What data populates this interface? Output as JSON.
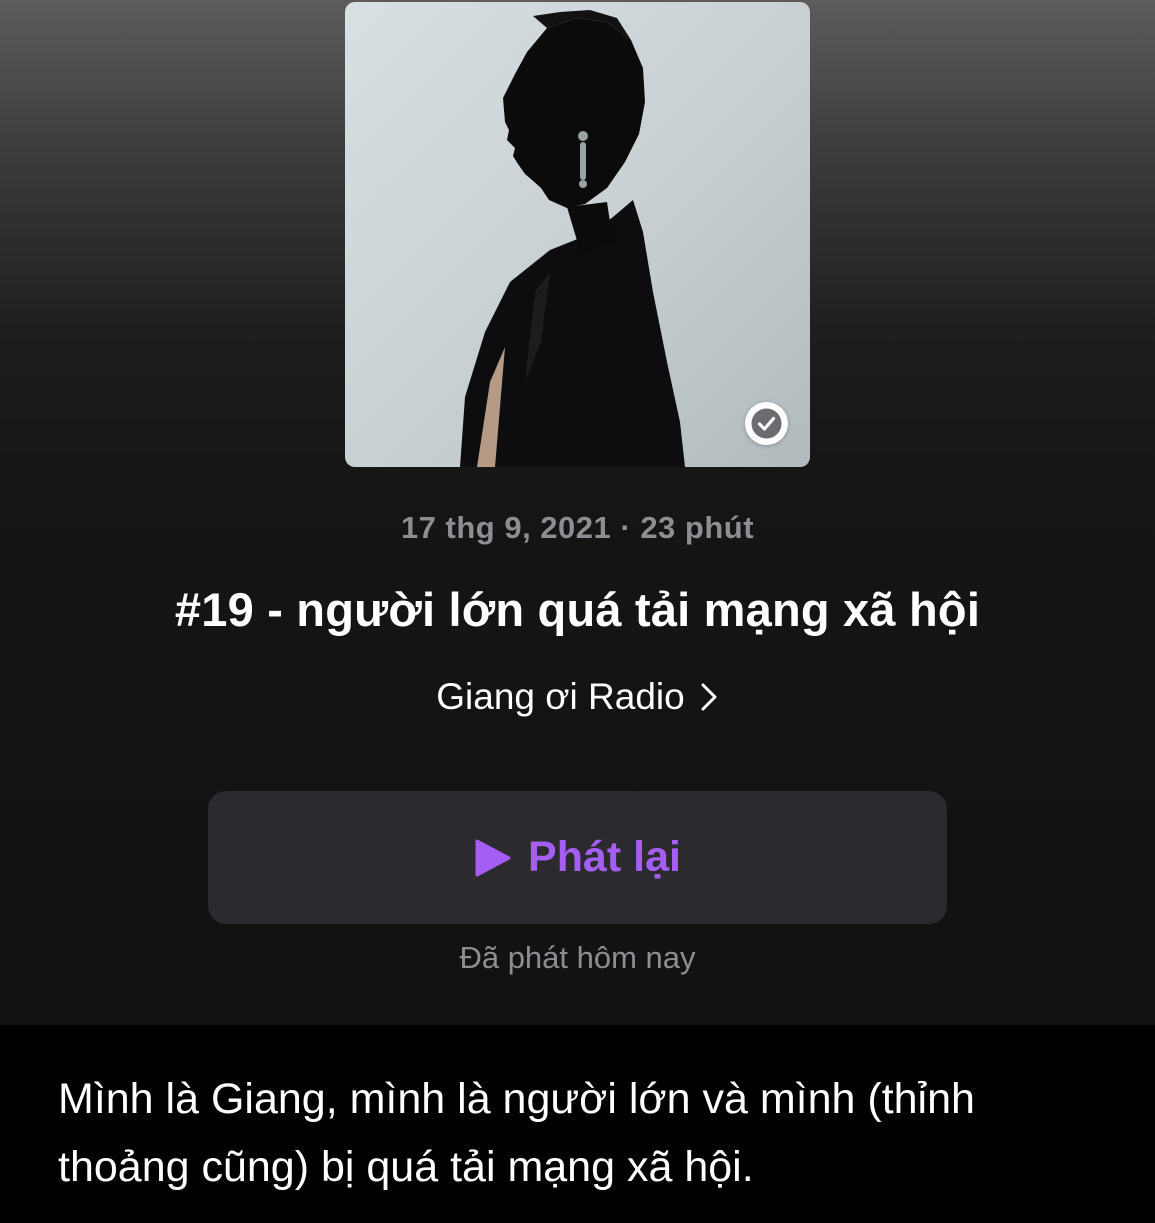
{
  "episode": {
    "artwork_icon": "podcast-cover-image",
    "played_badge_icon": "checkmark-circle-icon",
    "meta": "17 thg 9, 2021 · 23 phút",
    "title": "#19 - người lớn quá tải mạng xã hội",
    "show_name": "Giang ơi Radio",
    "show_chevron_icon": "chevron-right-icon",
    "play_button_label": "Phát lại",
    "play_icon": "play-icon",
    "played_status": "Đã phát hôm nay",
    "description": "Mình là Giang, mình là người lớn và mình (thỉnh thoảng cũng) bị quá tải mạng xã hội."
  },
  "colors": {
    "accent": "#a55ef3",
    "button_bg": "#2b2a2f",
    "secondary_text": "#8d8d92",
    "background": "#111111"
  }
}
